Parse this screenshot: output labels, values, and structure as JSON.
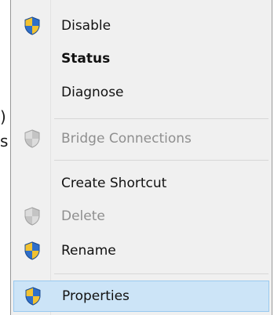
{
  "background": {
    "fragments": [
      ")",
      "s"
    ]
  },
  "menu": {
    "items": [
      {
        "label": "Disable",
        "icon": "uac-shield-icon",
        "enabled": true,
        "bold": false
      },
      {
        "label": "Status",
        "icon": null,
        "enabled": true,
        "bold": true
      },
      {
        "label": "Diagnose",
        "icon": null,
        "enabled": true,
        "bold": false
      },
      {
        "label": "Bridge Connections",
        "icon": "uac-shield-icon",
        "enabled": false,
        "bold": false
      },
      {
        "label": "Create Shortcut",
        "icon": null,
        "enabled": true,
        "bold": false
      },
      {
        "label": "Delete",
        "icon": "uac-shield-icon",
        "enabled": false,
        "bold": false
      },
      {
        "label": "Rename",
        "icon": "uac-shield-icon",
        "enabled": true,
        "bold": false
      },
      {
        "label": "Properties",
        "icon": "uac-shield-icon",
        "enabled": true,
        "bold": false,
        "highlighted": true
      }
    ]
  },
  "colors": {
    "menu_background": "#f0f0f0",
    "highlight_background": "#cce4f7",
    "highlight_border": "#99c9ef",
    "disabled_text": "#8f8f8f",
    "shield_blue": "#2f6fc9",
    "shield_yellow": "#f2c230"
  }
}
